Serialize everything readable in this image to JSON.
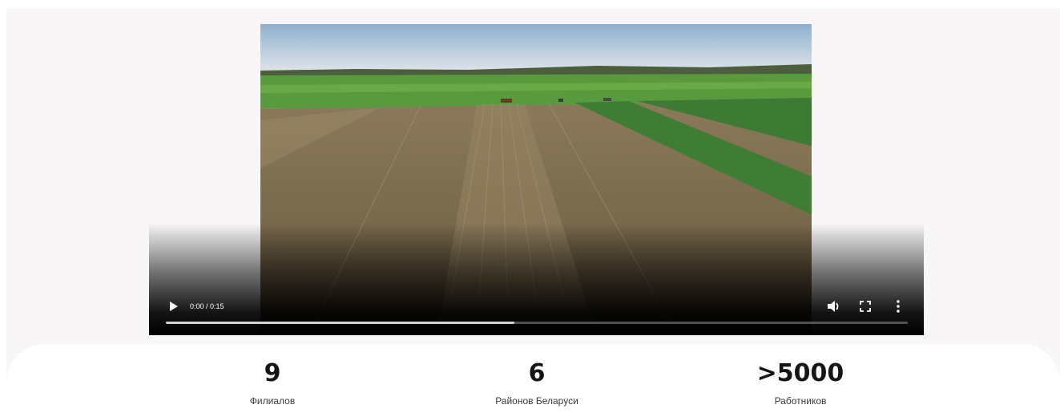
{
  "video": {
    "time_display": "0:00 / 0:15",
    "progress": 0.47,
    "controls": {
      "play_icon": "play-icon",
      "volume_icon": "volume-icon",
      "fullscreen_icon": "fullscreen-icon",
      "more_icon": "more-vert-icon"
    }
  },
  "stats": [
    {
      "value": "9",
      "label": "Филиалов"
    },
    {
      "value": "6",
      "label": "Районов Беларуси"
    },
    {
      "value": ">5000",
      "label": "Работников"
    }
  ],
  "colors": {
    "page_background": "#f8f6f7",
    "card_background": "#ffffff",
    "stat_text": "#151515"
  }
}
